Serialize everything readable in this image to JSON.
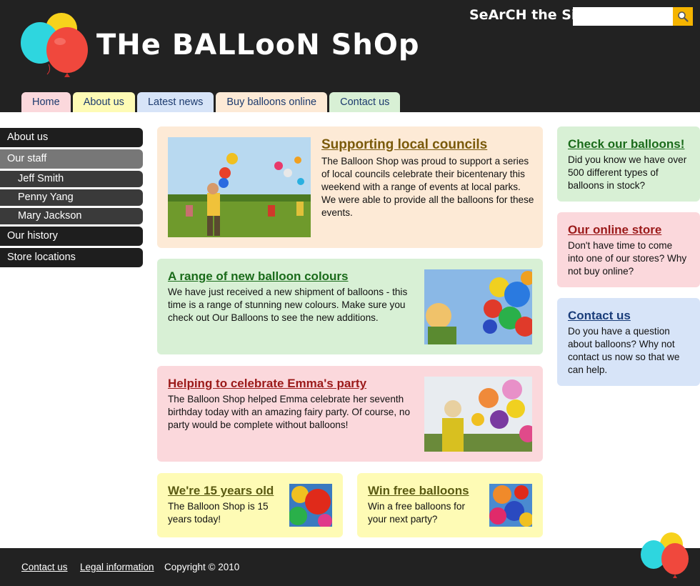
{
  "header": {
    "site_title": "THe BALLooN ShOp",
    "search_label": "SeArCH the SiTE",
    "search_placeholder": ""
  },
  "tabs": [
    {
      "label": "Home"
    },
    {
      "label": "About us"
    },
    {
      "label": "Latest news"
    },
    {
      "label": "Buy balloons online"
    },
    {
      "label": "Contact us"
    }
  ],
  "sidebar": {
    "items": [
      {
        "label": "About us"
      },
      {
        "label": "Our staff"
      },
      {
        "label": "Jeff Smith"
      },
      {
        "label": "Penny Yang"
      },
      {
        "label": "Mary Jackson"
      },
      {
        "label": "Our history"
      },
      {
        "label": "Store locations"
      }
    ]
  },
  "articles": {
    "councils": {
      "title": "Supporting local councils",
      "body": "The Balloon Shop was proud to support a series of local councils celebrate their bicentenary this weekend with a range of events at local parks. We were able to provide all the balloons for these events."
    },
    "colours": {
      "title": "A range of new balloon colours",
      "body": "We have just received a new shipment of balloons - this time is a range of stunning new colours. Make sure you check out Our Balloons to see the new additions."
    },
    "emma": {
      "title": "Helping to celebrate Emma's party",
      "body": "The Balloon Shop helped Emma celebrate her seventh birthday today with an amazing fairy party. Of course, no party would be complete without balloons!"
    },
    "years": {
      "title": "We're 15 years old",
      "body": "The Balloon Shop is 15 years today!"
    },
    "win": {
      "title": "Win free balloons",
      "body": "Win a free balloons for your next party?"
    }
  },
  "aside": {
    "check": {
      "title": "Check our balloons!",
      "body": "Did you know we have over 500 different types of balloons in stock?"
    },
    "online": {
      "title": "Our online store",
      "body": "Don't have time to come into one of our stores? Why not buy online?"
    },
    "contact": {
      "title": "Contact us",
      "body": "Do you have a question about balloons? Why not contact us now so that we can help."
    }
  },
  "footer": {
    "contact_label": "Contact us",
    "legal_label": "Legal information",
    "copyright": "Copyright © 2010"
  },
  "colors": {
    "header_bg": "#222222",
    "search_button": "#f5b400",
    "peach": "#fdead6",
    "green": "#d8f0d5",
    "pink": "#fbd8dc",
    "yellow": "#fefbb5",
    "blue": "#d7e4f8"
  },
  "icons": {
    "search": "magnifier-icon",
    "logo": "balloons-logo"
  }
}
